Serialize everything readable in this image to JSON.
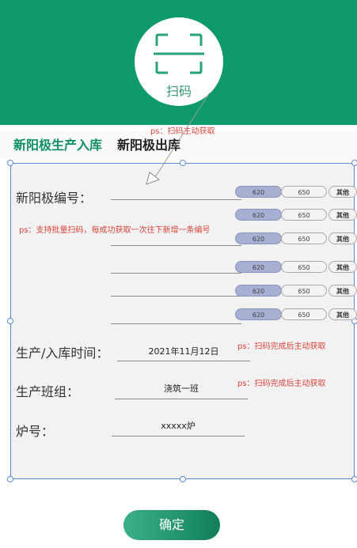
{
  "scan": {
    "label": "扫码"
  },
  "tabs": {
    "inbound": "新阳极生产入库",
    "outbound": "新阳极出库"
  },
  "notes": {
    "scan_auto": "ps：扫码主动获取",
    "batch": "ps：支持批量扫码，每成功获取一次往下新增一条编号",
    "time_auto": "ps：扫码完成后主动获取",
    "team_auto": "ps：扫码完成后主动获取"
  },
  "form": {
    "anode_no_label": "新阳极编号：",
    "time_label": "生产/入库时间：",
    "time_value": "2021年11月12日",
    "team_label": "生产班组：",
    "team_value": "浇筑一班",
    "furnace_label": "炉号：",
    "furnace_value": "xxxxx炉"
  },
  "rows": [
    {
      "a": "620",
      "b": "650",
      "c": "其他"
    },
    {
      "a": "620",
      "b": "650",
      "c": "其他"
    },
    {
      "a": "620",
      "b": "650",
      "c": "其他"
    },
    {
      "a": "620",
      "b": "650",
      "c": "其他"
    },
    {
      "a": "620",
      "b": "650",
      "c": "其他"
    },
    {
      "a": "620",
      "b": "650",
      "c": "其他"
    }
  ],
  "confirm_label": "确定",
  "colors": {
    "brand": "#0f9a6e",
    "selected_pill": "#a7afd2",
    "annotation": "#e0443b",
    "selection_border": "#5b8ad6"
  }
}
